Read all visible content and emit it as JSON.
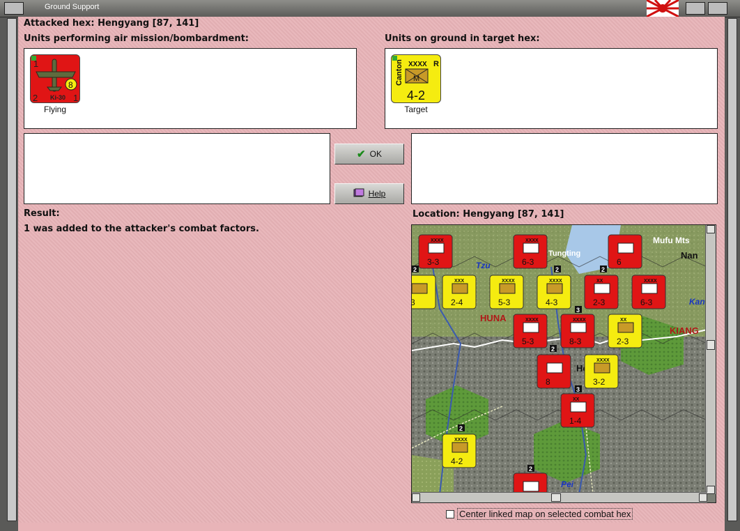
{
  "window": {
    "title": "Ground Support"
  },
  "header": {
    "attacked_hex": "Attacked hex: Hengyang  [87, 141]"
  },
  "air_units": {
    "label": "Units performing air mission/bombardment:",
    "items": [
      {
        "type": "Ki-30",
        "strength": "8",
        "top_left": "1",
        "bottom_left": "2",
        "bottom_right": "1",
        "caption": "Flying"
      }
    ]
  },
  "ground_units": {
    "label": "Units on ground in target hex:",
    "items": [
      {
        "name": "Canton",
        "size": "XXXX",
        "reserve": "R",
        "unit_type": "M",
        "factors": "4-2",
        "caption": "Target"
      }
    ]
  },
  "buttons": {
    "ok": "OK",
    "help": "Help"
  },
  "result": {
    "label": "Result:",
    "text": "1 was added to the attacker's combat factors."
  },
  "location": {
    "label": "Location:  Hengyang  [87, 141]"
  },
  "map": {
    "place_names": [
      "Mufu Mts",
      "Nan",
      "Tungting",
      "Tzu",
      "HUNA",
      "KIANG",
      "Kan",
      "Heng",
      "Pei"
    ],
    "counters": [
      {
        "side": "red",
        "size": "XXXX",
        "factors": "3-3"
      },
      {
        "side": "red",
        "size": "XXXX",
        "factors": "6-3"
      },
      {
        "side": "red",
        "size": "",
        "factors": "6"
      },
      {
        "side": "yellow",
        "size": "",
        "factors": "3"
      },
      {
        "side": "yellow",
        "size": "XXX",
        "factors": "2-4"
      },
      {
        "side": "yellow",
        "size": "XXXX",
        "factors": "5-3"
      },
      {
        "side": "yellow",
        "size": "XXXX",
        "factors": "4-3"
      },
      {
        "side": "red",
        "size": "XX",
        "factors": "2-3"
      },
      {
        "side": "red",
        "size": "XXXX",
        "factors": "6-3"
      },
      {
        "side": "red",
        "size": "XXXX",
        "factors": "5-3"
      },
      {
        "side": "red",
        "size": "XXXX",
        "factors": "8-3"
      },
      {
        "side": "yellow",
        "size": "XX",
        "factors": "2-3"
      },
      {
        "side": "red",
        "size": "",
        "factors": "8"
      },
      {
        "side": "yellow",
        "size": "XXXX",
        "factors": "3-2"
      },
      {
        "side": "red",
        "size": "XX",
        "factors": "1-4"
      },
      {
        "side": "yellow",
        "size": "XXXX",
        "factors": "4-2"
      },
      {
        "side": "red",
        "size": "",
        "factors": ""
      }
    ],
    "stack_badges": [
      "2",
      "2",
      "2",
      "3",
      "2",
      "3",
      "2",
      "2"
    ]
  },
  "option": {
    "center_linked_map": "Center linked map on selected combat hex",
    "checked": false
  },
  "colors": {
    "background": "#e8b4b8",
    "axis_counter": "#e01515",
    "allied_counter": "#f5ec10"
  }
}
